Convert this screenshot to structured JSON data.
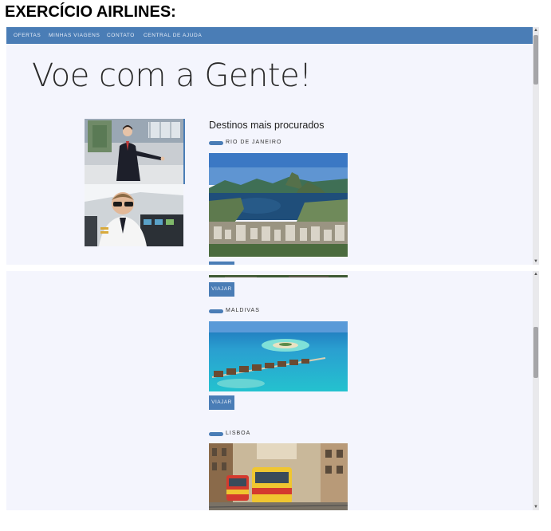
{
  "page": {
    "heading": "EXERCÍCIO AIRLINES:"
  },
  "nav": {
    "items": [
      {
        "label": "OFERTAS"
      },
      {
        "label": "MINHAS VIAGENS"
      },
      {
        "label": "CONTATO"
      },
      {
        "label": "CENTRAL DE AJUDA"
      }
    ]
  },
  "hero": {
    "title": "Voe com a Gente!"
  },
  "destinations": {
    "title": "Destinos mais procurados",
    "button_label": "VIAJAR",
    "items": [
      {
        "name": "RIO DE JANEIRO"
      },
      {
        "name": "MALDIVAS"
      },
      {
        "name": "LISBOA"
      }
    ]
  },
  "colors": {
    "accent": "#4a7db6",
    "background": "#f4f5fd"
  }
}
